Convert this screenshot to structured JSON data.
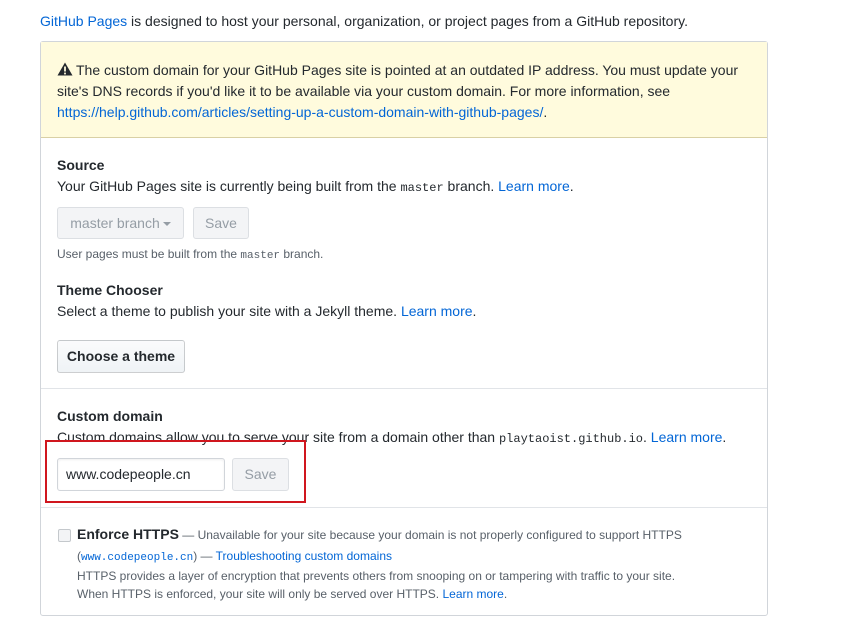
{
  "intro": {
    "link": "GitHub Pages",
    "text": " is designed to host your personal, organization, or project pages from a GitHub repository."
  },
  "warning": {
    "icon": "alert-icon",
    "line1": "The custom domain for your GitHub Pages site is pointed at an outdated IP address. You must update your",
    "line2": "site's DNS records if you'd like it to be available via your custom domain. For more information, see",
    "link": "https://help.github.com/articles/setting-up-a-custom-domain-with-github-pages/",
    "after_link": "."
  },
  "source": {
    "title": "Source",
    "desc_pre": "Your GitHub Pages site is currently being built from the ",
    "branch": "master",
    "desc_post": " branch. ",
    "learn_more": "Learn more",
    "period": ".",
    "select_label": "master branch",
    "save_label": "Save",
    "note_pre": "User pages must be built from the ",
    "note_branch": "master",
    "note_post": " branch."
  },
  "theme": {
    "title": "Theme Chooser",
    "desc": "Select a theme to publish your site with a Jekyll theme. ",
    "learn_more": "Learn more",
    "period": ".",
    "button": "Choose a theme"
  },
  "custom_domain": {
    "title": "Custom domain",
    "desc_pre": "Custom domains allow you to serve your site from a domain other than ",
    "default_domain": "playtaoist.github.io",
    "desc_post": ". ",
    "learn_more": "Learn more",
    "period": ".",
    "value": "www.codepeople.cn",
    "save_label": "Save"
  },
  "https": {
    "title": "Enforce HTTPS",
    "dash": " — ",
    "reason": "Unavailable for your site because your domain is not properly configured to support HTTPS",
    "paren_open": "(",
    "domain": "www.codepeople.cn",
    "paren_close": ")",
    "troubleshoot": "Troubleshooting custom domains",
    "line3": "HTTPS provides a layer of encryption that prevents others from snooping on or tampering with traffic to your site.",
    "line4": "When HTTPS is enforced, your site will only be served over HTTPS. ",
    "learn_more": "Learn more",
    "period": "."
  },
  "colors": {
    "link": "#0366d6",
    "warning_bg": "#fffbdd",
    "highlight": "#d0161e"
  }
}
